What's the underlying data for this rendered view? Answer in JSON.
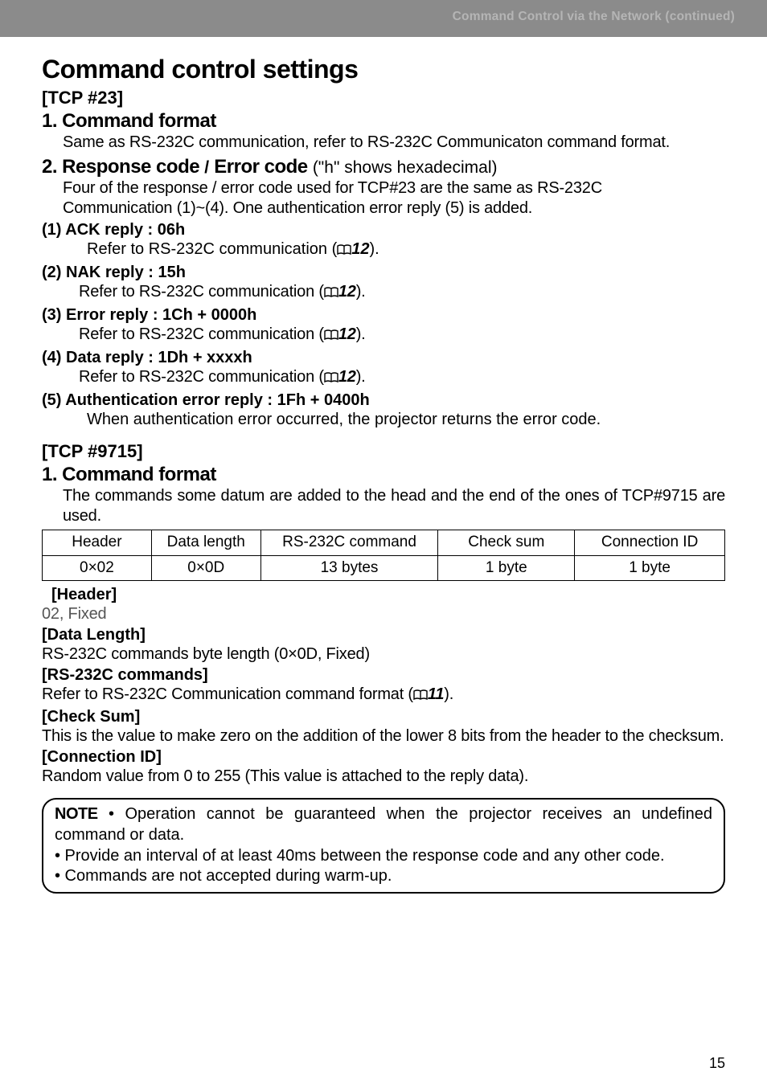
{
  "banner": {
    "text": "Command Control via the Network (continued)"
  },
  "title": "Command control settings",
  "tcp23": {
    "label": "[TCP #23]",
    "s1_title": "1. Command format",
    "s1_text": "Same as RS-232C communication, refer to RS-232C Communicaton command format.",
    "s2_title": "2. Response code ",
    "s2_slash": "/",
    "s2_title2": " Error code ",
    "s2_paren": "(\"h\" shows hexadecimal)",
    "s2_text1": "Four of the response / error code used for TCP#23 are the same as RS-232C",
    "s2_text2": "Communication (1)~(4). One authentication error reply (5) is added.",
    "items": [
      {
        "head": "(1) ACK reply : 06h",
        "body_pre": "Refer to RS-232C communication (",
        "ref": "12",
        "body_post": ")."
      },
      {
        "head": "(2) NAK reply : 15h",
        "body_pre": "Refer to RS-232C communication (",
        "ref": "12",
        "body_post": ")."
      },
      {
        "head": "(3) Error reply : 1Ch + 0000h",
        "body_pre": "Refer to RS-232C communication (",
        "ref": "12",
        "body_post": ")."
      },
      {
        "head": "(4) Data reply : 1Dh + xxxxh",
        "body_pre": "Refer to RS-232C communication (",
        "ref": "12",
        "body_post": ")."
      },
      {
        "head": "(5) Authentication error reply : 1Fh + 0400h",
        "body_pre": "When authentication error occurred, the projector returns the error code.",
        "ref": "",
        "body_post": ""
      }
    ]
  },
  "tcp9715": {
    "label": "[TCP #9715]",
    "s1_title": "1. Command format",
    "s1_text": "The commands some datum are added to the head and the end of the ones of TCP#9715 are used.",
    "table": {
      "headers": [
        "Header",
        "Data length",
        "RS-232C command",
        "Check sum",
        "Connection ID"
      ],
      "row": [
        "0×02",
        "0×0D",
        "13 bytes",
        "1 byte",
        "1 byte"
      ]
    },
    "details": {
      "header_lbl": "[Header]",
      "header_txt": "02, Fixed",
      "datalen_lbl": "[Data Length]",
      "datalen_txt": "RS-232C commands byte length (0×0D, Fixed)",
      "rs_lbl": "[RS-232C commands]",
      "rs_txt_pre": "Refer to RS-232C Communication command format (",
      "rs_ref": "11",
      "rs_txt_post": ").",
      "check_lbl": "[Check Sum]",
      "check_txt": "This is the value to make zero on the addition of the lower 8 bits from the header to the checksum.",
      "conn_lbl": "[Connection ID]",
      "conn_txt": "Random value from 0 to 255 (This value is attached to the reply data)."
    }
  },
  "note": {
    "label": "NOTE",
    "l1": " • Operation cannot be guaranteed when the projector receives an undefined command or data.",
    "l2": "• Provide an interval of at least 40ms between the response code and any other code.",
    "l3": " • Commands are not accepted during warm-up."
  },
  "page": "15"
}
